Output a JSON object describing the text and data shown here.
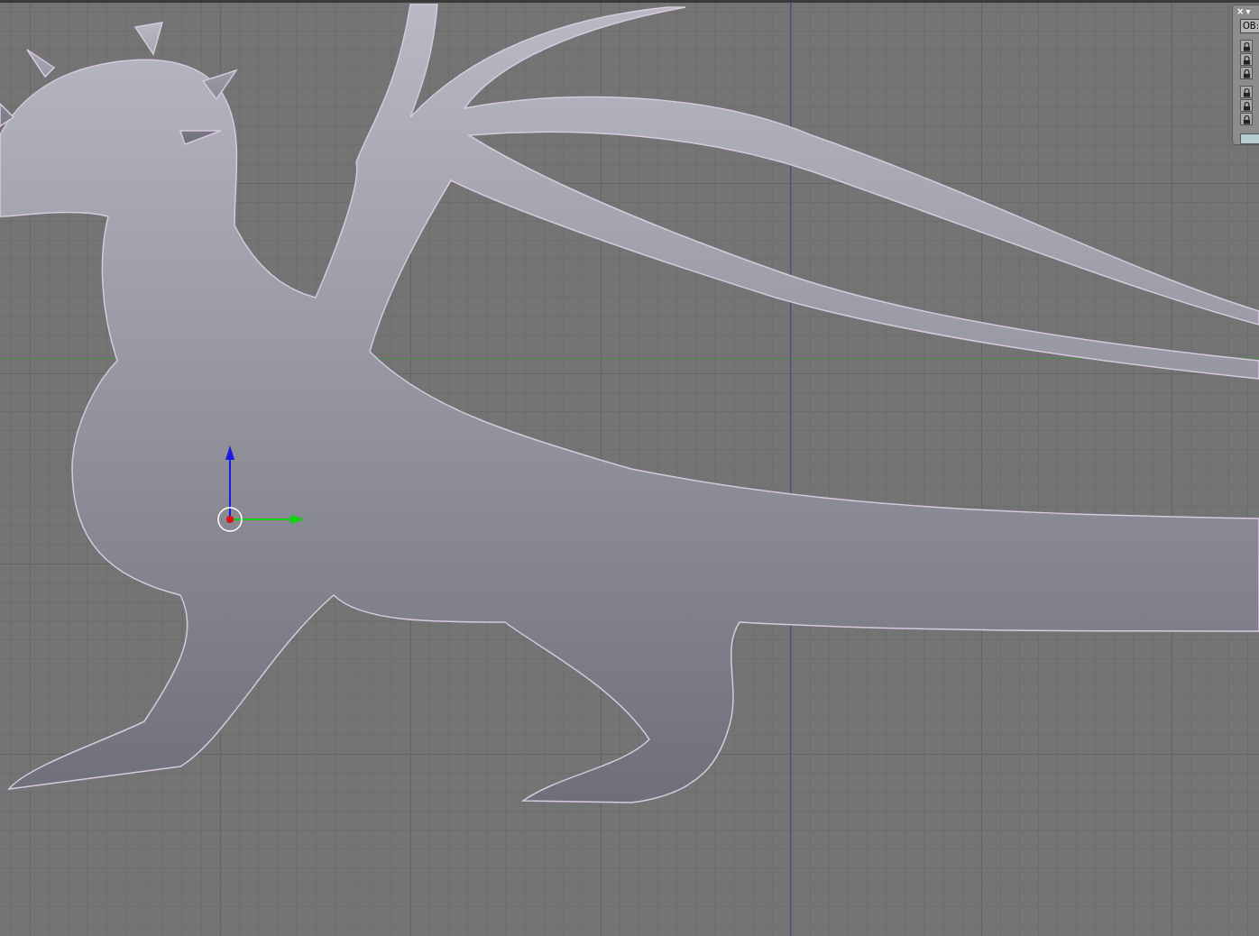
{
  "properties_panel": {
    "close_glyph": "×",
    "menu_glyph": "▾",
    "object_field": {
      "label": "OB:"
    },
    "lock_groups": [
      {
        "locks": [
          {
            "locked": true
          },
          {
            "locked": true
          },
          {
            "locked": true
          }
        ]
      },
      {
        "locks": [
          {
            "locked": true
          },
          {
            "locked": true
          },
          {
            "locked": true
          }
        ]
      }
    ]
  }
}
